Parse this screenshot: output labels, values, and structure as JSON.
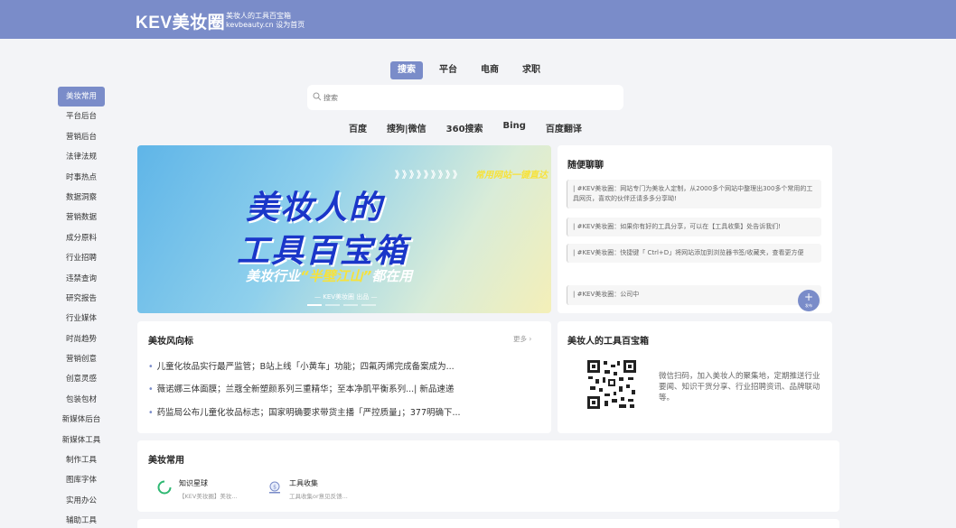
{
  "header": {
    "logo": "KEV美妆圈",
    "tagline": "美妆人的工具百宝箱",
    "tagline_sub": "kevbeauty.cn 设为首页"
  },
  "sidebar": {
    "items": [
      {
        "label": "美妆常用",
        "active": true
      },
      {
        "label": "平台后台"
      },
      {
        "label": "营销后台"
      },
      {
        "label": "法律法规"
      },
      {
        "label": "时事热点"
      },
      {
        "label": "数据洞察"
      },
      {
        "label": "营销数据"
      },
      {
        "label": "成分原料"
      },
      {
        "label": "行业招聘"
      },
      {
        "label": "违禁查询"
      },
      {
        "label": "研究报告"
      },
      {
        "label": "行业媒体"
      },
      {
        "label": "时尚趋势"
      },
      {
        "label": "营销创意"
      },
      {
        "label": "创意灵感"
      },
      {
        "label": "包装包材"
      },
      {
        "label": "新媒体后台"
      },
      {
        "label": "新媒体工具"
      },
      {
        "label": "制作工具"
      },
      {
        "label": "图库字体"
      },
      {
        "label": "实用办公"
      },
      {
        "label": "辅助工具"
      }
    ]
  },
  "search": {
    "tabs": [
      "搜索",
      "平台",
      "电商",
      "求职"
    ],
    "active_tab": "搜索",
    "placeholder": "搜索",
    "engines": [
      "百度",
      "搜狗|微信",
      "360搜索",
      "Bing",
      "百度翻译"
    ]
  },
  "banner": {
    "arrows": "》》》》》》》》》",
    "hot": "常用网站一键直达",
    "line1": "美妆人的",
    "line2": "工具百宝箱",
    "line3_a": "美妆行业",
    "line3_hl": "“半壁江山”",
    "line3_b": "都在用",
    "kev": "— KEV美妆圈 出品 —"
  },
  "chat": {
    "title": "随便聊聊",
    "items": [
      "| #KEV美妆圈：网站专门为美妆人定制，从2000多个网站中整理出300多个常用的工具网页，喜欢的伙伴还请多多分享呦!",
      "| #KEV美妆圈：如果你有好的工具分享，可以在【工具收集】处告诉我们!",
      "| #KEV美妆圈：快捷键「 Ctrl+D」将网站添加到浏览器书签/收藏夹，查看更方便",
      "| #KEV美妆圈：公司中"
    ],
    "fab_label": "发布"
  },
  "news": {
    "title": "美妆风向标",
    "more": "更多 ›",
    "items": [
      "儿童化妆品实行最严监管；B站上线「小黄车」功能；四氟丙烯完成备案成为...",
      "薇诺娜三体面膜；兰蔻全新塑颜系列三重精华；至本净肌平衡系列...| 新品速递",
      "药监局公布儿童化妆品标志；国家明确要求带货主播「严控质量」；377明确下..."
    ]
  },
  "qrcard": {
    "title": "美妆人的工具百宝箱",
    "desc": "微信扫码，加入美妆人的聚集地，定期推送行业要闻、知识干货分享、行业招聘资讯、品牌联动等。"
  },
  "common": {
    "title": "美妆常用",
    "tools": [
      {
        "name": "知识星球",
        "desc": "【KEV美妆圈】美妆..."
      },
      {
        "name": "工具收集",
        "desc": "工具收集or意见反馈..."
      }
    ]
  },
  "colors": {
    "accent": "#7a8cc9",
    "background": "#f3f4f7"
  }
}
